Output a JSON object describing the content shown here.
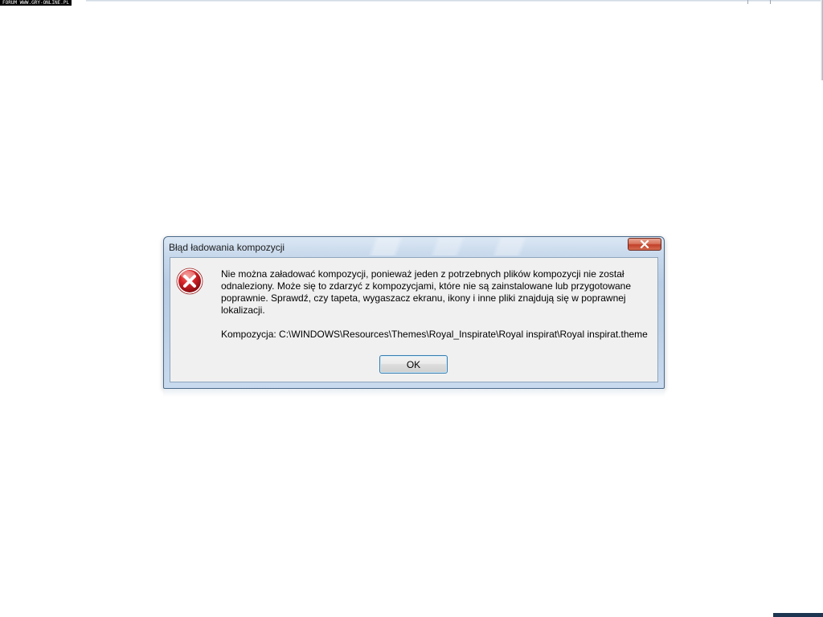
{
  "watermark": "FORUM WWW.GRY-ONLINE.PL",
  "dialog": {
    "title": "Błąd ładowania kompozycji",
    "close_icon": "close-x-icon",
    "error_icon": "error-x-circle-icon",
    "message": "Nie można załadować kompozycji, ponieważ jeden z potrzebnych plików kompozycji nie został odnaleziony. Może się to zdarzyć z kompozycjami, które nie są zainstalowane lub przygotowane poprawnie. Sprawdź, czy tapeta, wygaszacz ekranu, ikony i inne pliki znajdują się w poprawnej lokalizacji.",
    "theme_path": "Kompozycja: C:\\WINDOWS\\Resources\\Themes\\Royal_Inspirate\\Royal inspirat\\Royal inspirat.theme",
    "ok_label": "OK"
  },
  "colors": {
    "close_button": "#c2402a",
    "error_icon": "#c81e1e",
    "title_bar": "#bcd0e6",
    "client_bg": "#f0f0f0"
  }
}
